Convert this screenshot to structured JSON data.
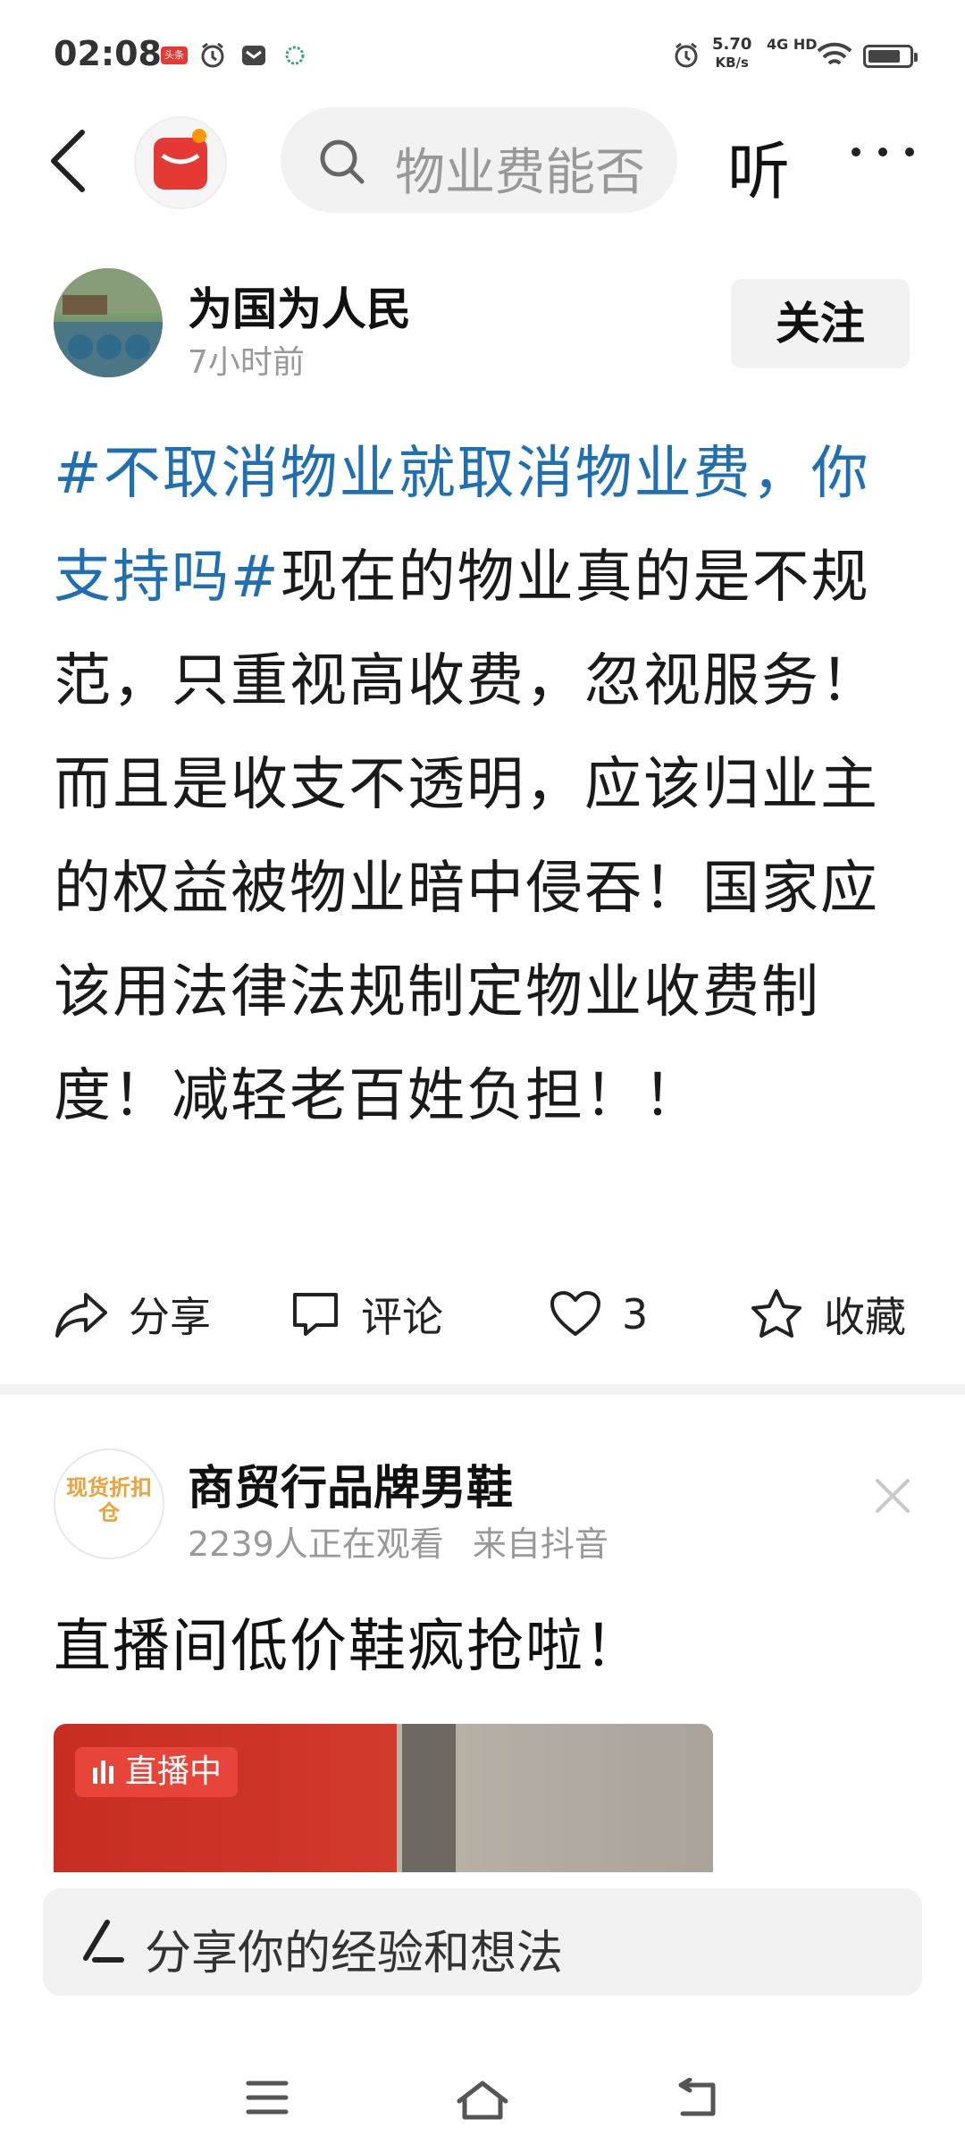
{
  "status_bar": {
    "time": "02:08",
    "app_badge": "头条",
    "net_speed_value": "5.70",
    "net_speed_unit": "KB/s",
    "network": "4G HD"
  },
  "top_bar": {
    "search_text": "物业费能否",
    "listen_label": "听"
  },
  "post": {
    "author": "为国为人民",
    "time": "7小时前",
    "follow_label": "关注",
    "topic": "#不取消物业就取消物业费，你支持吗#",
    "body": "现在的物业真的是不规范，只重视高收费，忽视服务！而且是收支不透明，应该归业主的权益被物业暗中侵吞！国家应该用法律法规制定物业收费制度！减轻老百姓负担！！"
  },
  "actions": {
    "share": "分享",
    "comment": "评论",
    "like_count": "3",
    "favorite": "收藏"
  },
  "ad": {
    "avatar_text": "现货折扣仓",
    "name": "商贸行品牌男鞋",
    "viewers": "2239人正在观看",
    "source": "来自抖音",
    "text": "直播间低价鞋疯抢啦！",
    "live_label": "直播中"
  },
  "comment_box": {
    "placeholder": "分享你的经验和想法"
  },
  "icons": {
    "status": [
      "alarm-icon",
      "messenger-icon",
      "signal-app-icon",
      "alarm-icon",
      "wifi-icon",
      "battery-icon"
    ],
    "accent_blue": "#1f6fb2",
    "live_red": "#e8453a"
  }
}
